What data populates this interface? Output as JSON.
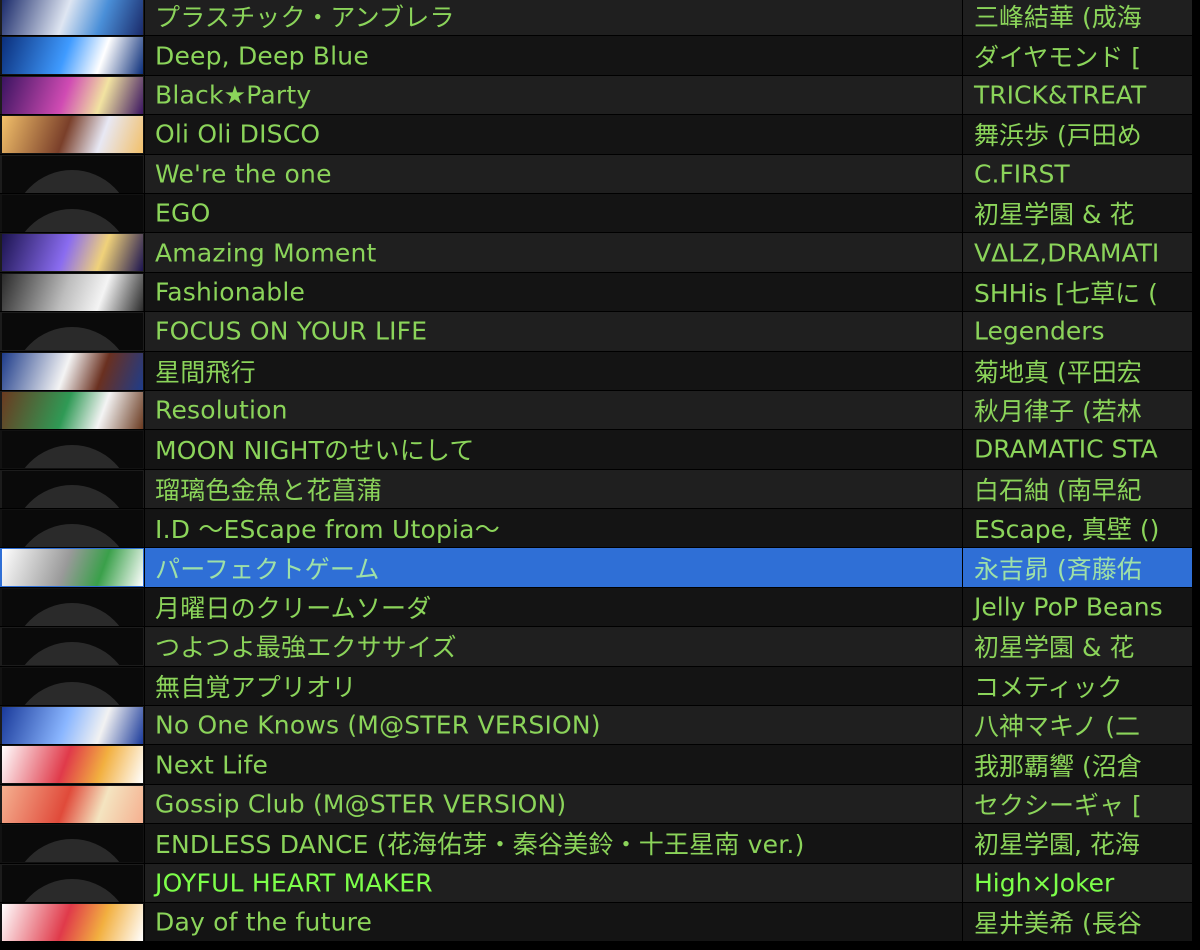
{
  "tracks": [
    {
      "title": "プラスチック・アンブレラ",
      "artist": "三峰結華 (成海",
      "art": "cover-icon",
      "art_colors": [
        "#1a2a6a",
        "#dfe6f2",
        "#4a8fd8"
      ]
    },
    {
      "title": "Deep, Deep Blue",
      "artist": "ダイヤモンド [",
      "art": "cover-icon",
      "art_colors": [
        "#0b2e7a",
        "#3f9bff",
        "#ffffff"
      ]
    },
    {
      "title": "Black★Party",
      "artist": "TRICK&TREAT",
      "art": "cover-icon",
      "art_colors": [
        "#3a1460",
        "#d04bb3",
        "#f2e3a1"
      ]
    },
    {
      "title": "Oli Oli DISCO",
      "artist": "舞浜歩 (戸田め",
      "art": "cover-icon",
      "art_colors": [
        "#f2c06a",
        "#7a3f2a",
        "#e8e8f4"
      ]
    },
    {
      "title": "We're the one",
      "artist": "C.FIRST",
      "art": "placeholder"
    },
    {
      "title": "EGO",
      "artist": "初星学園 & 花",
      "art": "placeholder"
    },
    {
      "title": "Amazing Moment",
      "artist": "VΔLZ,DRAMATI",
      "art": "cover-icon",
      "art_colors": [
        "#1c1450",
        "#8a6cf0",
        "#f0d27a"
      ]
    },
    {
      "title": "Fashionable",
      "artist": "SHHis [七草に (",
      "art": "cover-icon",
      "art_colors": [
        "#2a2a2a",
        "#bdbdbd",
        "#f4f4f4"
      ]
    },
    {
      "title": "FOCUS ON YOUR LIFE",
      "artist": "Legenders",
      "art": "placeholder"
    },
    {
      "title": "星間飛行",
      "artist": "菊地真 (平田宏",
      "art": "cover-icon",
      "art_colors": [
        "#1e3c8a",
        "#f4f4f4",
        "#6a3020"
      ]
    },
    {
      "title": "Resolution",
      "artist": "秋月律子 (若林",
      "art": "cover-icon",
      "art_colors": [
        "#6a3a20",
        "#2f9a55",
        "#f4f4f4"
      ]
    },
    {
      "title": "MOON NIGHTのせいにして",
      "artist": "DRAMATIC STA",
      "art": "placeholder"
    },
    {
      "title": "瑠璃色金魚と花菖蒲",
      "artist": "白石紬 (南早紀",
      "art": "placeholder"
    },
    {
      "title": "I.D 〜EScape from Utopia〜",
      "artist": "EScape, 真壁 ()",
      "art": "placeholder"
    },
    {
      "title": "パーフェクトゲーム",
      "artist": "永吉昴 (斉藤佑",
      "art": "cover-icon",
      "art_colors": [
        "#ffffff",
        "#9a9a9a",
        "#3aa04a"
      ],
      "selected": true
    },
    {
      "title": "月曜日のクリームソーダ",
      "artist": "Jelly PoP Beans",
      "art": "placeholder"
    },
    {
      "title": "つよつよ最強エクササイズ",
      "artist": "初星学園 & 花",
      "art": "placeholder"
    },
    {
      "title": "無自覚アプリオリ",
      "artist": "コメティック",
      "art": "placeholder"
    },
    {
      "title": "No One Knows (M@STER VERSION)",
      "artist": "八神マキノ (二",
      "art": "cover-icon",
      "art_colors": [
        "#1a3a9a",
        "#8ab6ff",
        "#f2f2f2"
      ]
    },
    {
      "title": "Next Life",
      "artist": "我那覇響 (沼倉",
      "art": "cover-icon",
      "art_colors": [
        "#ffffff",
        "#e03a4a",
        "#f2b040"
      ]
    },
    {
      "title": "Gossip Club (M@STER VERSION)",
      "artist": "セクシーギャ [",
      "art": "cover-icon",
      "art_colors": [
        "#f5b090",
        "#e04a3a",
        "#f4e4c0"
      ]
    },
    {
      "title": "ENDLESS DANCE (花海佑芽・秦谷美鈴・十王星南 ver.)",
      "artist": "初星学園, 花海",
      "art": "placeholder"
    },
    {
      "title": "JOYFUL HEART MAKER",
      "artist": "High×Joker",
      "art": "placeholder",
      "bright": true
    },
    {
      "title": "Day of the future",
      "artist": "星井美希 (長谷",
      "art": "cover-icon",
      "art_colors": [
        "#ffffff",
        "#e03a4a",
        "#f2b040"
      ]
    }
  ]
}
